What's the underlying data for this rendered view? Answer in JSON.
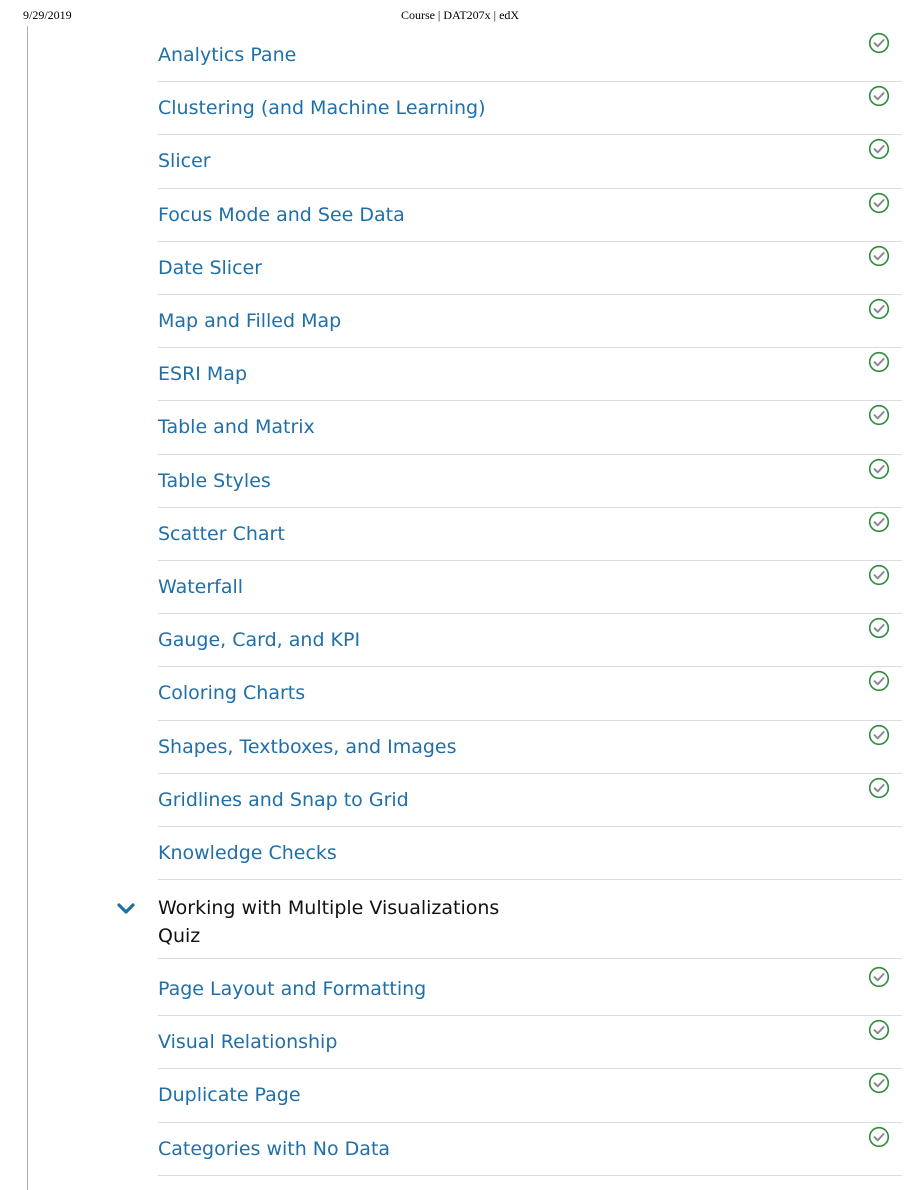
{
  "print_header": {
    "date": "9/29/2019",
    "title": "Course | DAT207x | edX"
  },
  "colors": {
    "link": "#1f6fa8",
    "check": "#2e8b3d",
    "chevron": "#1f6fa8"
  },
  "items_before": [
    {
      "label": "Analytics Pane",
      "completed": true
    },
    {
      "label": "Clustering (and Machine Learning)",
      "completed": true
    },
    {
      "label": "Slicer",
      "completed": true
    },
    {
      "label": "Focus Mode and See Data",
      "completed": true
    },
    {
      "label": "Date Slicer",
      "completed": true
    },
    {
      "label": "Map and Filled Map",
      "completed": true
    },
    {
      "label": "ESRI Map",
      "completed": true
    },
    {
      "label": "Table and Matrix",
      "completed": true
    },
    {
      "label": "Table Styles",
      "completed": true
    },
    {
      "label": "Scatter Chart",
      "completed": true
    },
    {
      "label": "Waterfall",
      "completed": true
    },
    {
      "label": "Gauge, Card, and KPI",
      "completed": true
    },
    {
      "label": "Coloring Charts",
      "completed": true
    },
    {
      "label": "Shapes, Textboxes, and Images",
      "completed": true
    },
    {
      "label": "Gridlines and Snap to Grid",
      "completed": true
    },
    {
      "label": "Knowledge Checks",
      "completed": false
    }
  ],
  "section": {
    "title": "Working with Multiple Visualizations",
    "subtitle": "Quiz",
    "icon": "chevron-down-icon"
  },
  "items_after": [
    {
      "label": "Page Layout and Formatting",
      "completed": true
    },
    {
      "label": "Visual Relationship",
      "completed": true
    },
    {
      "label": "Duplicate Page",
      "completed": true
    },
    {
      "label": "Categories with No Data",
      "completed": true
    }
  ]
}
